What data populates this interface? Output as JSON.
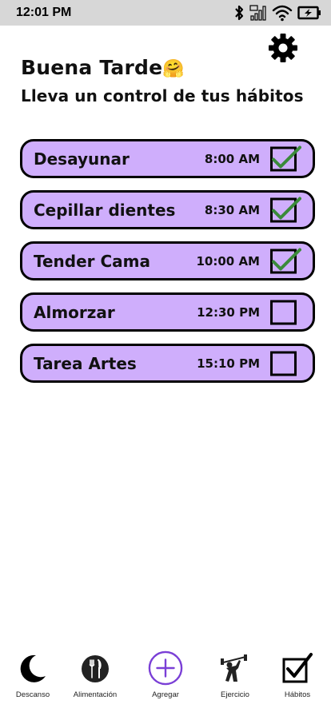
{
  "status_bar": {
    "time": "12:01 PM",
    "icons": [
      "bluetooth-icon",
      "signal-icon",
      "wifi-icon",
      "battery-charging-icon"
    ]
  },
  "header": {
    "settings_icon": "gear-icon",
    "greeting": "Buena Tarde",
    "greeting_emoji": "🤗",
    "subtitle": "Lleva un control de tus hábitos"
  },
  "habits": [
    {
      "name": "Desayunar",
      "time": "8:00 AM",
      "done": true
    },
    {
      "name": "Cepillar dientes",
      "time": "8:30 AM",
      "done": true
    },
    {
      "name": "Tender Cama",
      "time": "10:00 AM",
      "done": true
    },
    {
      "name": "Almorzar",
      "time": "12:30 PM",
      "done": false
    },
    {
      "name": "Tarea Artes",
      "time": "15:10 PM",
      "done": false
    }
  ],
  "colors": {
    "card_background": "#cfaefc",
    "check_green": "#3a8a3a",
    "accent_purple": "#7a3fd6",
    "status_bar": "#d7d7d7"
  },
  "bottom_nav": [
    {
      "label": "Descanso",
      "icon": "moon-icon"
    },
    {
      "label": "Alimentación",
      "icon": "fork-knife-icon"
    },
    {
      "label": "Agregar",
      "icon": "plus-circle-icon"
    },
    {
      "label": "Ejercicio",
      "icon": "weightlifter-icon"
    },
    {
      "label": "Hábitos",
      "icon": "checkbox-icon"
    }
  ]
}
